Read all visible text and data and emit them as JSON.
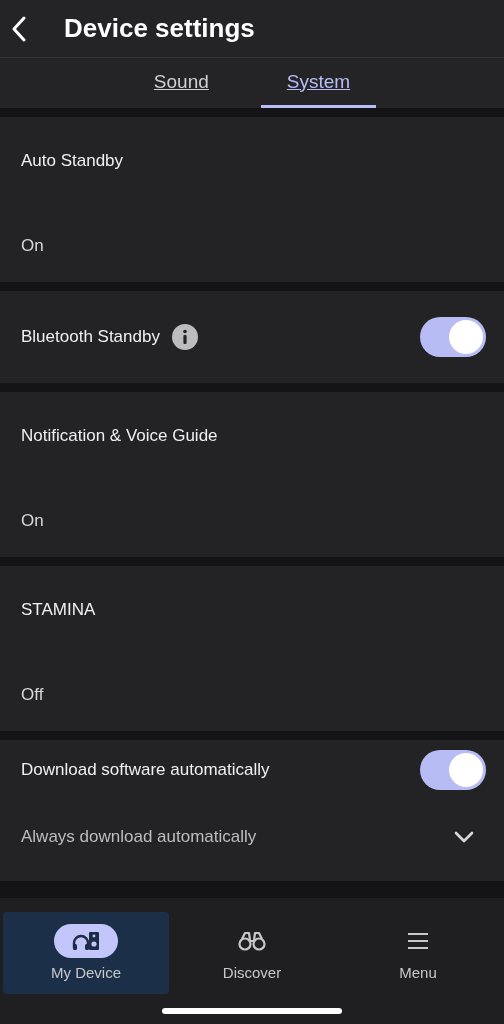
{
  "header": {
    "title": "Device settings"
  },
  "tabs": [
    {
      "label": "Sound",
      "selected": false
    },
    {
      "label": "System",
      "selected": true
    }
  ],
  "settings": [
    {
      "kind": "value",
      "label": "Auto Standby",
      "value": "On"
    },
    {
      "kind": "toggle",
      "label": "Bluetooth Standby",
      "info": true,
      "on": true
    },
    {
      "kind": "value",
      "label": "Notification & Voice Guide",
      "value": "On"
    },
    {
      "kind": "value",
      "label": "STAMINA",
      "value": "Off"
    },
    {
      "kind": "toggle_option",
      "label": "Download software automatically",
      "on": true,
      "option": "Always download automatically"
    }
  ],
  "nav": [
    {
      "label": "My Device",
      "kind": "device",
      "selected": true
    },
    {
      "label": "Discover",
      "kind": "discover",
      "selected": false
    },
    {
      "label": "Menu",
      "kind": "menu",
      "selected": false
    }
  ]
}
